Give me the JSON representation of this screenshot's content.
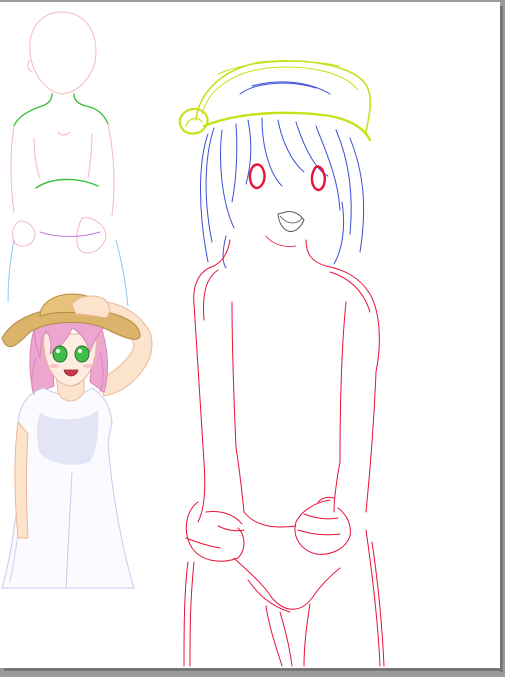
{
  "colors": {
    "background": "#9a9a9a",
    "canvas": "#ffffff",
    "red_lines": "#e8123a",
    "blue_lines": "#3b4fd6",
    "yellow_lines": "#c8e01a",
    "green_lines": "#22c422",
    "pink_hair": "#e996c8",
    "hat": "#d9b46a",
    "eyes": "#3fbf4a"
  }
}
